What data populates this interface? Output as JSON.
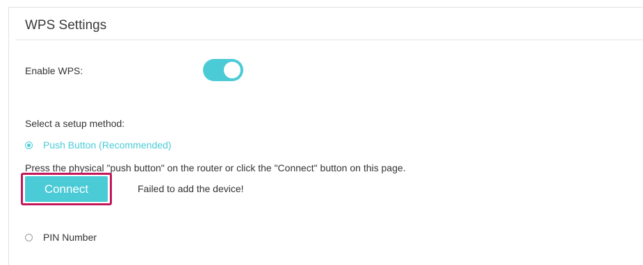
{
  "section": {
    "title": "WPS Settings"
  },
  "enable_wps": {
    "label": "Enable WPS:",
    "state": "on"
  },
  "setup": {
    "prompt": "Select a setup method:",
    "push_button_option": "Push Button (Recommended)",
    "instruction": "Press the physical \"push button\" on the router or click the \"Connect\" button on this page.",
    "connect_label": "Connect",
    "status_message": "Failed to add the device!",
    "pin_option": "PIN Number",
    "selected": "push_button"
  },
  "colors": {
    "accent": "#4acbd6",
    "highlight_border": "#c2185b"
  }
}
